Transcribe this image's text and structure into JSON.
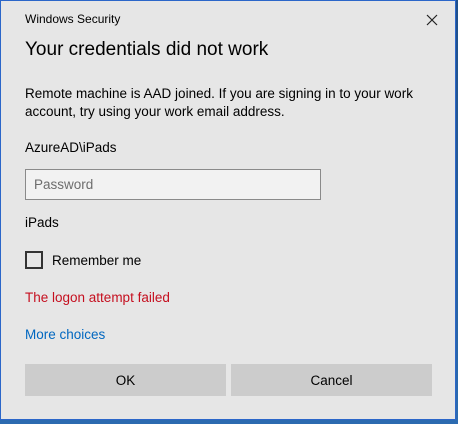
{
  "window": {
    "title": "Windows Security",
    "close_icon": "close-icon"
  },
  "dialog": {
    "heading": "Your credentials did not work",
    "message": "Remote machine is AAD joined. If you are signing in to your work account, try using your work email address.",
    "username": "AzureAD\\iPads",
    "password": {
      "value": "",
      "placeholder": "Password"
    },
    "domain_label": "iPads",
    "remember": {
      "label": "Remember me",
      "checked": false
    },
    "error_text": "The logon attempt failed",
    "error_color": "#c50f1f",
    "more_choices": "More choices",
    "link_color": "#0067c0",
    "buttons": {
      "ok": "OK",
      "cancel": "Cancel"
    }
  }
}
